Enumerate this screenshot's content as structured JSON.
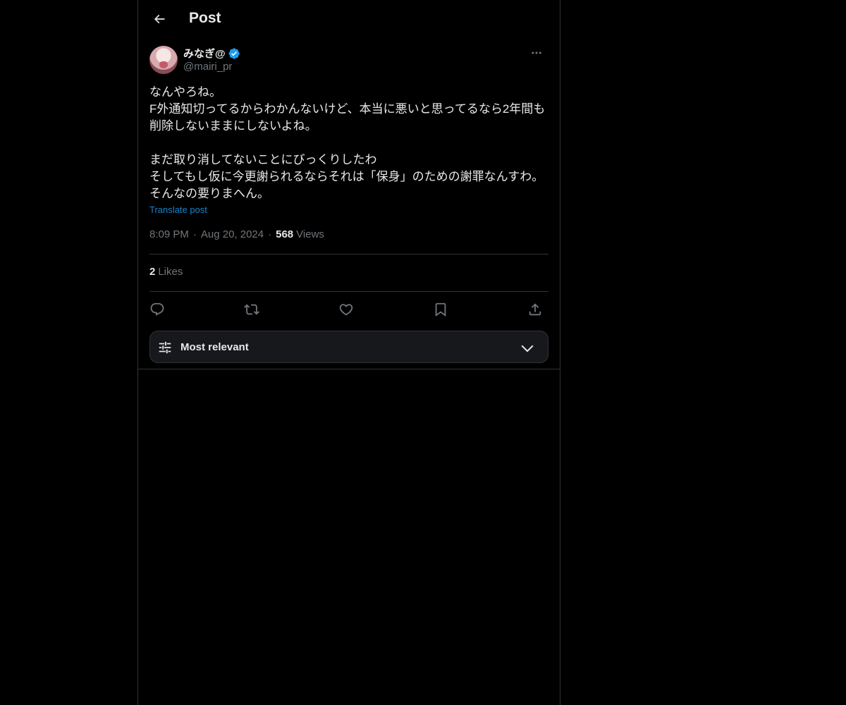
{
  "header": {
    "title": "Post",
    "back_icon": "arrow-left-icon"
  },
  "author": {
    "display_name": "みなぎ@",
    "handle": "@mairi_pr",
    "verified": true,
    "verified_color": "#1d9bf0"
  },
  "post": {
    "text": "なんやろね。\nF外通知切ってるからわかんないけど、本当に悪いと思ってるなら2年間も\n削除しないままにしないよね。\n\nまだ取り消してないことにびっくりしたわ\nそしてもし仮に今更謝られるならそれは「保身」のための謝罪なんすわ。\nそんなの要りまへん。",
    "translate_label": "Translate post",
    "time": "8:09 PM",
    "separator": "·",
    "date": "Aug 20, 2024",
    "views_count": "568",
    "views_label": "Views"
  },
  "engagement": {
    "likes_count": "2",
    "likes_label": "Likes"
  },
  "actions": {
    "icons": [
      "reply-icon",
      "repost-icon",
      "like-icon",
      "bookmark-icon",
      "share-icon"
    ]
  },
  "sort": {
    "label": "Most relevant",
    "icon": "sliders-icon",
    "chevron": "chevron-down-icon"
  },
  "colors": {
    "background": "#000000",
    "text_primary": "#e7e9ea",
    "text_secondary": "#71767b",
    "accent": "#1d9bf0",
    "border": "#2f3336"
  }
}
